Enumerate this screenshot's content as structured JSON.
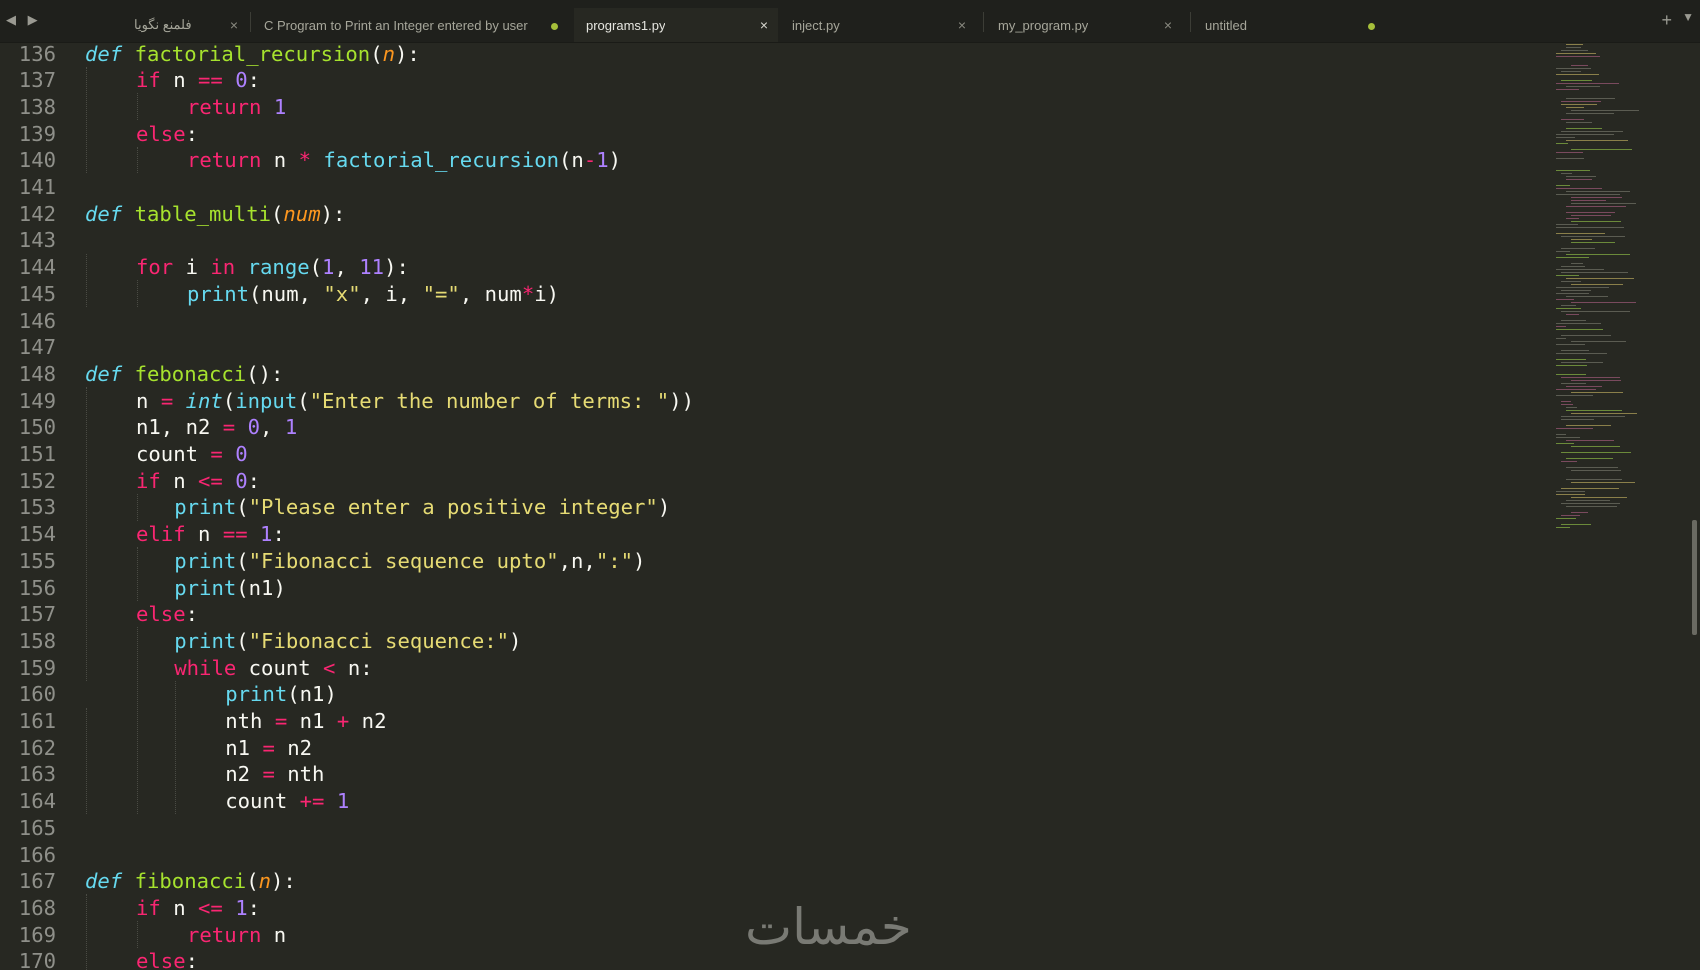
{
  "tabs": [
    {
      "label": "فلمنع نگویا",
      "state": "close"
    },
    {
      "label": "C Program to Print an Integer entered by user",
      "state": "dirty"
    },
    {
      "label": "programs1.py",
      "state": "close",
      "active": true
    },
    {
      "label": "inject.py",
      "state": "close"
    },
    {
      "label": "my_program.py",
      "state": "close"
    },
    {
      "label": "untitled",
      "state": "dirty"
    }
  ],
  "tabbar": {
    "nav_arrows": "◀ ▶",
    "new_tab": "+",
    "menu": "▼"
  },
  "code_lines": [
    {
      "n": "136",
      "indent": 0,
      "tokens": [
        [
          "df",
          "def"
        ],
        [
          "p",
          " "
        ],
        [
          "fn",
          "factorial_recursion"
        ],
        [
          "p",
          "("
        ],
        [
          "pa",
          "n"
        ],
        [
          "p",
          "):"
        ]
      ]
    },
    {
      "n": "137",
      "indent": 1,
      "tokens": [
        [
          "kw",
          "if"
        ],
        [
          "p",
          " n "
        ],
        [
          "op",
          "=="
        ],
        [
          "p",
          " "
        ],
        [
          "nu",
          "0"
        ],
        [
          "p",
          ":"
        ]
      ]
    },
    {
      "n": "138",
      "indent": 2,
      "tokens": [
        [
          "kw",
          "return"
        ],
        [
          "p",
          " "
        ],
        [
          "nu",
          "1"
        ]
      ]
    },
    {
      "n": "139",
      "indent": 1,
      "tokens": [
        [
          "kw",
          "else"
        ],
        [
          "p",
          ":"
        ]
      ]
    },
    {
      "n": "140",
      "indent": 2,
      "tokens": [
        [
          "kw",
          "return"
        ],
        [
          "p",
          " n "
        ],
        [
          "op",
          "*"
        ],
        [
          "p",
          " "
        ],
        [
          "bi",
          "factorial_recursion"
        ],
        [
          "p",
          "(n"
        ],
        [
          "op",
          "-"
        ],
        [
          "nu",
          "1"
        ],
        [
          "p",
          ")"
        ]
      ]
    },
    {
      "n": "141",
      "indent": 0,
      "tokens": []
    },
    {
      "n": "142",
      "indent": 0,
      "tokens": [
        [
          "df",
          "def"
        ],
        [
          "p",
          " "
        ],
        [
          "fn",
          "table_multi"
        ],
        [
          "p",
          "("
        ],
        [
          "pa",
          "num"
        ],
        [
          "p",
          "):"
        ]
      ]
    },
    {
      "n": "143",
      "indent": 0,
      "tokens": []
    },
    {
      "n": "144",
      "indent": 1,
      "tokens": [
        [
          "kw",
          "for"
        ],
        [
          "p",
          " i "
        ],
        [
          "kw",
          "in"
        ],
        [
          "p",
          " "
        ],
        [
          "bi",
          "range"
        ],
        [
          "p",
          "("
        ],
        [
          "nu",
          "1"
        ],
        [
          "p",
          ", "
        ],
        [
          "nu",
          "11"
        ],
        [
          "p",
          "):"
        ]
      ]
    },
    {
      "n": "145",
      "indent": 2,
      "tokens": [
        [
          "bi",
          "print"
        ],
        [
          "p",
          "(num, "
        ],
        [
          "st",
          "\"x\""
        ],
        [
          "p",
          ", i, "
        ],
        [
          "st",
          "\"=\""
        ],
        [
          "p",
          ", num"
        ],
        [
          "op",
          "*"
        ],
        [
          "p",
          "i)"
        ]
      ]
    },
    {
      "n": "146",
      "indent": 0,
      "tokens": []
    },
    {
      "n": "147",
      "indent": 0,
      "tokens": []
    },
    {
      "n": "148",
      "indent": 0,
      "tokens": [
        [
          "df",
          "def"
        ],
        [
          "p",
          " "
        ],
        [
          "fn",
          "febonacci"
        ],
        [
          "p",
          "():"
        ]
      ]
    },
    {
      "n": "149",
      "indent": 1,
      "tokens": [
        [
          "p",
          "n "
        ],
        [
          "op",
          "="
        ],
        [
          "p",
          " "
        ],
        [
          "ti",
          "int"
        ],
        [
          "p",
          "("
        ],
        [
          "bi",
          "input"
        ],
        [
          "p",
          "("
        ],
        [
          "st",
          "\"Enter the number of terms: \""
        ],
        [
          "p",
          "))"
        ]
      ]
    },
    {
      "n": "150",
      "indent": 1,
      "tokens": [
        [
          "p",
          "n1, n2 "
        ],
        [
          "op",
          "="
        ],
        [
          "p",
          " "
        ],
        [
          "nu",
          "0"
        ],
        [
          "p",
          ", "
        ],
        [
          "nu",
          "1"
        ]
      ]
    },
    {
      "n": "151",
      "indent": 1,
      "tokens": [
        [
          "p",
          "count "
        ],
        [
          "op",
          "="
        ],
        [
          "p",
          " "
        ],
        [
          "nu",
          "0"
        ]
      ]
    },
    {
      "n": "152",
      "indent": 1,
      "tokens": [
        [
          "kw",
          "if"
        ],
        [
          "p",
          " n "
        ],
        [
          "op",
          "<="
        ],
        [
          "p",
          " "
        ],
        [
          "nu",
          "0"
        ],
        [
          "p",
          ":"
        ]
      ]
    },
    {
      "n": "153",
      "indent": 1.75,
      "tokens": [
        [
          "bi",
          "print"
        ],
        [
          "p",
          "("
        ],
        [
          "st",
          "\"Please enter a positive integer\""
        ],
        [
          "p",
          ")"
        ]
      ]
    },
    {
      "n": "154",
      "indent": 1,
      "tokens": [
        [
          "kw",
          "elif"
        ],
        [
          "p",
          " n "
        ],
        [
          "op",
          "=="
        ],
        [
          "p",
          " "
        ],
        [
          "nu",
          "1"
        ],
        [
          "p",
          ":"
        ]
      ]
    },
    {
      "n": "155",
      "indent": 1.75,
      "tokens": [
        [
          "bi",
          "print"
        ],
        [
          "p",
          "("
        ],
        [
          "st",
          "\"Fibonacci sequence upto\""
        ],
        [
          "p",
          ",n,"
        ],
        [
          "st",
          "\":\""
        ],
        [
          "p",
          ")"
        ]
      ]
    },
    {
      "n": "156",
      "indent": 1.75,
      "tokens": [
        [
          "bi",
          "print"
        ],
        [
          "p",
          "(n1)"
        ]
      ]
    },
    {
      "n": "157",
      "indent": 1,
      "tokens": [
        [
          "kw",
          "else"
        ],
        [
          "p",
          ":"
        ]
      ]
    },
    {
      "n": "158",
      "indent": 1.75,
      "tokens": [
        [
          "bi",
          "print"
        ],
        [
          "p",
          "("
        ],
        [
          "st",
          "\"Fibonacci sequence:\""
        ],
        [
          "p",
          ")"
        ]
      ]
    },
    {
      "n": "159",
      "indent": 1.75,
      "tokens": [
        [
          "kw",
          "while"
        ],
        [
          "p",
          " count "
        ],
        [
          "op",
          "<"
        ],
        [
          "p",
          " n:"
        ]
      ]
    },
    {
      "n": "160",
      "indent": 2.75,
      "tokens": [
        [
          "bi",
          "print"
        ],
        [
          "p",
          "(n1)"
        ]
      ]
    },
    {
      "n": "161",
      "indent": 2.75,
      "tokens": [
        [
          "p",
          "nth "
        ],
        [
          "op",
          "="
        ],
        [
          "p",
          " n1 "
        ],
        [
          "op",
          "+"
        ],
        [
          "p",
          " n2"
        ]
      ]
    },
    {
      "n": "162",
      "indent": 2.75,
      "tokens": [
        [
          "p",
          "n1 "
        ],
        [
          "op",
          "="
        ],
        [
          "p",
          " n2"
        ]
      ]
    },
    {
      "n": "163",
      "indent": 2.75,
      "tokens": [
        [
          "p",
          "n2 "
        ],
        [
          "op",
          "="
        ],
        [
          "p",
          " nth"
        ]
      ]
    },
    {
      "n": "164",
      "indent": 2.75,
      "tokens": [
        [
          "p",
          "count "
        ],
        [
          "op",
          "+="
        ],
        [
          "p",
          " "
        ],
        [
          "nu",
          "1"
        ]
      ]
    },
    {
      "n": "165",
      "indent": 0,
      "tokens": []
    },
    {
      "n": "166",
      "indent": 0,
      "tokens": []
    },
    {
      "n": "167",
      "indent": 0,
      "tokens": [
        [
          "df",
          "def"
        ],
        [
          "p",
          " "
        ],
        [
          "fn",
          "fibonacci"
        ],
        [
          "p",
          "("
        ],
        [
          "pa",
          "n"
        ],
        [
          "p",
          "):"
        ]
      ]
    },
    {
      "n": "168",
      "indent": 1,
      "tokens": [
        [
          "kw",
          "if"
        ],
        [
          "p",
          " n "
        ],
        [
          "op",
          "<="
        ],
        [
          "p",
          " "
        ],
        [
          "nu",
          "1"
        ],
        [
          "p",
          ":"
        ]
      ]
    },
    {
      "n": "169",
      "indent": 2,
      "tokens": [
        [
          "kw",
          "return"
        ],
        [
          "p",
          " n"
        ]
      ]
    },
    {
      "n": "170",
      "indent": 1,
      "tokens": [
        [
          "kw",
          "else"
        ],
        [
          "p",
          ":"
        ]
      ]
    }
  ],
  "colors": {
    "background": "#272822",
    "keyword": "#f92672",
    "function": "#a6e22e",
    "builtin": "#66d9ef",
    "param": "#fd971f",
    "number": "#ae81ff",
    "string": "#e6db74"
  },
  "watermark": "خمسات"
}
